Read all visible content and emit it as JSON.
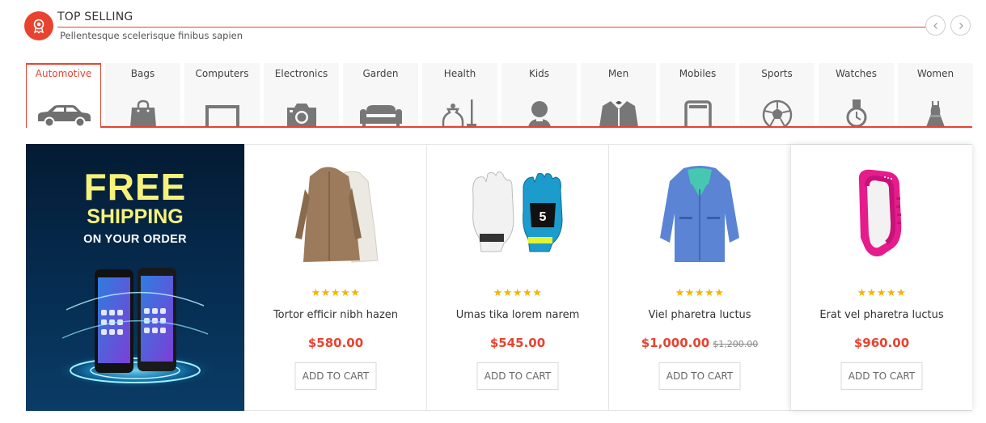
{
  "header": {
    "title": "TOP SELLING",
    "subtitle": "Pellentesque scelerisque finibus sapien"
  },
  "colors": {
    "accent": "#e8432f",
    "banner_yellow": "#f6f27a",
    "star": "#f5b400"
  },
  "tabs": [
    {
      "label": "Automotive",
      "icon": "car-icon",
      "active": true
    },
    {
      "label": "Bags",
      "icon": "bag-icon"
    },
    {
      "label": "Computers",
      "icon": "monitor-icon"
    },
    {
      "label": "Electronics",
      "icon": "camera-icon"
    },
    {
      "label": "Garden",
      "icon": "sofa-icon"
    },
    {
      "label": "Health",
      "icon": "health-icon"
    },
    {
      "label": "Kids",
      "icon": "kid-icon"
    },
    {
      "label": "Men",
      "icon": "suit-icon"
    },
    {
      "label": "Mobiles",
      "icon": "phone-icon"
    },
    {
      "label": "Sports",
      "icon": "soccer-ball-icon"
    },
    {
      "label": "Watches",
      "icon": "watch-icon"
    },
    {
      "label": "Women",
      "icon": "dress-icon"
    }
  ],
  "banner": {
    "line1": "FREE",
    "line2": "SHIPPING",
    "line3": "ON YOUR ORDER"
  },
  "products": [
    {
      "name": "Tortor efficir nibh hazen",
      "price": "$580.00",
      "old_price": "",
      "rating": 5,
      "image": "coat-image",
      "button": "ADD TO CART"
    },
    {
      "name": "Umas tika lorem narem",
      "price": "$545.00",
      "old_price": "",
      "rating": 5,
      "image": "goalkeeper-gloves-image",
      "button": "ADD TO CART"
    },
    {
      "name": "Viel pharetra luctus",
      "price": "$1,000.00",
      "old_price": "$1,200.00",
      "rating": 5,
      "image": "jacket-image",
      "button": "ADD TO CART"
    },
    {
      "name": "Erat vel pharetra luctus",
      "price": "$960.00",
      "old_price": "",
      "rating": 5,
      "image": "fitness-band-image",
      "button": "ADD TO CART"
    }
  ]
}
